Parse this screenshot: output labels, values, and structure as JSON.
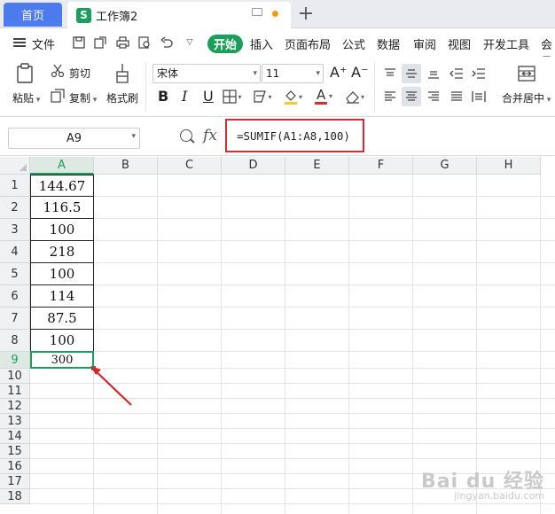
{
  "tabs": {
    "home_label": "首页",
    "doc_logo": "S",
    "doc_title": "工作簿2",
    "add_label": "+"
  },
  "menu": {
    "file_label": "文件",
    "items": [
      "开始",
      "插入",
      "页面布局",
      "公式",
      "数据",
      "审阅",
      "视图",
      "开发工具",
      "会员"
    ]
  },
  "ribbon": {
    "paste_label": "粘贴",
    "cut_label": "剪切",
    "copy_label": "复制",
    "format_painter_label": "格式刷",
    "font_name": "宋体",
    "font_size": "11",
    "bold": "B",
    "italic": "I",
    "underline": "U",
    "font_color_glyph": "A",
    "grow_font": "A⁺",
    "shrink_font": "A⁻",
    "merge_label": "合并居中"
  },
  "formula_bar": {
    "name_box": "A9",
    "fx_label": "fx",
    "formula": "=SUMIF(A1:A8,100)"
  },
  "grid": {
    "columns": [
      "A",
      "B",
      "C",
      "D",
      "E",
      "F",
      "G",
      "H"
    ],
    "rows": [
      "1",
      "2",
      "3",
      "4",
      "5",
      "6",
      "7",
      "8",
      "9",
      "10",
      "11",
      "12",
      "13",
      "14",
      "15",
      "16",
      "17",
      "18"
    ],
    "active_column": "A",
    "active_row": "9",
    "column_a_values": [
      "144.67",
      "116.5",
      "100",
      "218",
      "100",
      "114",
      "87.5",
      "100"
    ],
    "result_value": "300"
  },
  "colors": {
    "accent_green": "#1a9e5a",
    "home_tab_blue": "#4b7bec",
    "highlight_red": "#e0282d"
  },
  "watermark": {
    "text": "Bai du 经验",
    "sub": "jingyan.baidu.com"
  }
}
